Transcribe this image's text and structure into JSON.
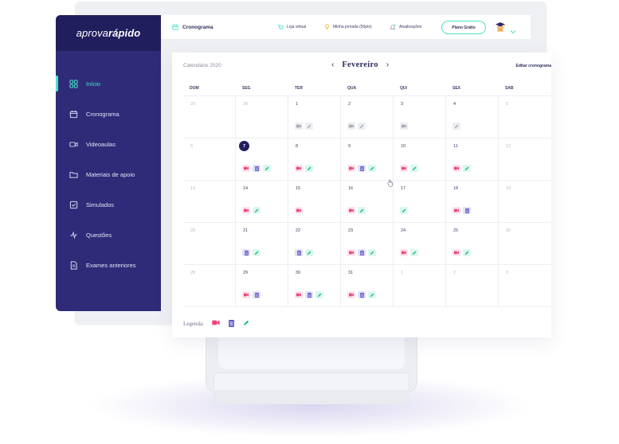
{
  "brand": {
    "logo_light": "aprova",
    "logo_bold": "rápido"
  },
  "colors": {
    "sidebar": "#2f2b78",
    "sidebar_dark": "#211e5e",
    "accent": "#4de0c8",
    "video": "#f2457a",
    "doc": "#5b54c8",
    "exercise": "#1fb98a",
    "done": "#a7a9b5"
  },
  "sidebar": {
    "items": [
      {
        "label": "Início",
        "icon": "grid-icon",
        "active": true
      },
      {
        "label": "Cronograma",
        "icon": "calendar-icon",
        "active": false
      },
      {
        "label": "Videoaulas",
        "icon": "video-icon",
        "active": false
      },
      {
        "label": "Materiais de apoio",
        "icon": "folder-icon",
        "active": false
      },
      {
        "label": "Simulados",
        "icon": "checkbox-icon",
        "active": false
      },
      {
        "label": "Questões",
        "icon": "bolt-icon",
        "active": false
      },
      {
        "label": "Exames anteriores",
        "icon": "document-icon",
        "active": false
      }
    ]
  },
  "header": {
    "title": "Cronograma",
    "store": "Loja virtual",
    "journey": "Minha jornada (50pts)",
    "updates": "Atualizações",
    "plan_button": "Plano Grátis"
  },
  "calendar": {
    "year_label": "Calendário 2020",
    "month": "Fevereiro",
    "prev_arrow": "‹",
    "next_arrow": "›",
    "edit_link": "Editar cronograma",
    "weekdays": [
      "DOM",
      "SEG",
      "TER",
      "QUA",
      "QUI",
      "SEX",
      "SAB"
    ],
    "weeks": [
      [
        {
          "n": "29",
          "muted": true,
          "items": []
        },
        {
          "n": "30",
          "muted": true,
          "items": []
        },
        {
          "n": "1",
          "items": [
            "done-video",
            "done-exercise"
          ]
        },
        {
          "n": "2",
          "items": [
            "done-video",
            "done-exercise"
          ]
        },
        {
          "n": "3",
          "items": [
            "done-video"
          ]
        },
        {
          "n": "4",
          "items": [
            "done-exercise"
          ]
        },
        {
          "n": "5",
          "muted": true,
          "items": []
        }
      ],
      [
        {
          "n": "6",
          "muted": true,
          "items": []
        },
        {
          "n": "7",
          "today": true,
          "items": [
            "video",
            "doc",
            "exercise"
          ]
        },
        {
          "n": "8",
          "items": [
            "video",
            "exercise"
          ]
        },
        {
          "n": "9",
          "items": [
            "video",
            "doc",
            "exercise"
          ]
        },
        {
          "n": "10",
          "items": [
            "video",
            "exercise"
          ]
        },
        {
          "n": "11",
          "items": [
            "video",
            "exercise"
          ]
        },
        {
          "n": "12",
          "muted": true,
          "items": []
        }
      ],
      [
        {
          "n": "13",
          "muted": true,
          "items": []
        },
        {
          "n": "14",
          "items": [
            "video",
            "exercise"
          ]
        },
        {
          "n": "15",
          "items": [
            "video"
          ]
        },
        {
          "n": "16",
          "items": [
            "video",
            "exercise"
          ]
        },
        {
          "n": "17",
          "items": [
            "exercise"
          ]
        },
        {
          "n": "18",
          "items": [
            "video",
            "doc"
          ]
        },
        {
          "n": "19",
          "muted": true,
          "items": []
        }
      ],
      [
        {
          "n": "20",
          "muted": true,
          "items": []
        },
        {
          "n": "21",
          "items": [
            "doc",
            "exercise"
          ]
        },
        {
          "n": "22",
          "items": [
            "doc",
            "exercise"
          ]
        },
        {
          "n": "23",
          "items": [
            "video",
            "doc",
            "exercise"
          ]
        },
        {
          "n": "24",
          "items": [
            "video",
            "exercise"
          ]
        },
        {
          "n": "25",
          "items": [
            "video",
            "exercise"
          ]
        },
        {
          "n": "26",
          "muted": true,
          "items": []
        }
      ],
      [
        {
          "n": "28",
          "muted": true,
          "items": []
        },
        {
          "n": "29",
          "items": [
            "video",
            "doc"
          ]
        },
        {
          "n": "30",
          "items": [
            "video",
            "doc",
            "exercise"
          ]
        },
        {
          "n": "31",
          "items": [
            "video",
            "doc",
            "exercise"
          ]
        },
        {
          "n": "1",
          "muted": true,
          "items": []
        },
        {
          "n": "2",
          "muted": true,
          "items": []
        },
        {
          "n": "3",
          "muted": true,
          "items": []
        }
      ]
    ]
  },
  "legend": {
    "label": "Legenda:",
    "items": [
      "video",
      "doc",
      "exercise"
    ]
  }
}
